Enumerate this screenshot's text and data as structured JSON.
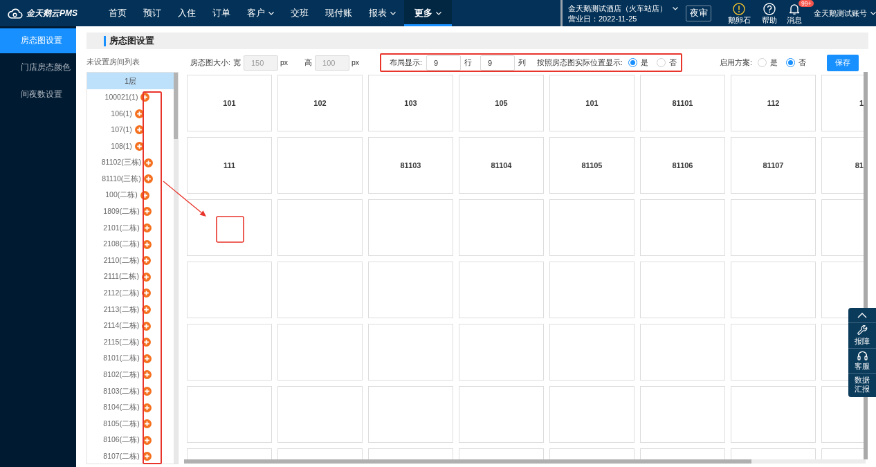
{
  "navbar": {
    "logo": "金天鹅云PMS",
    "items": [
      {
        "label": "首页",
        "dropdown": false,
        "selected": false
      },
      {
        "label": "预订",
        "dropdown": false,
        "selected": false
      },
      {
        "label": "入住",
        "dropdown": false,
        "selected": false
      },
      {
        "label": "订单",
        "dropdown": false,
        "selected": false
      },
      {
        "label": "客户",
        "dropdown": true,
        "selected": false
      },
      {
        "label": "交班",
        "dropdown": false,
        "selected": false
      },
      {
        "label": "现付账",
        "dropdown": false,
        "selected": false
      },
      {
        "label": "报表",
        "dropdown": true,
        "selected": false
      },
      {
        "label": "更多",
        "dropdown": true,
        "selected": true
      }
    ],
    "hotel": {
      "name": "金天鹅测试酒店（火车站店）",
      "business_date": "营业日：2022-11-25"
    },
    "night_audit_button": "夜审",
    "tools": [
      {
        "kind": "alert",
        "label": "鹅卵石"
      },
      {
        "kind": "help",
        "label": "帮助"
      },
      {
        "kind": "messages",
        "label": "消息",
        "badge": "99+"
      }
    ],
    "account": "金天鹅测试账号"
  },
  "sidebar": {
    "items": [
      {
        "label": "房态图设置",
        "selected": true
      },
      {
        "label": "门店房态颜色",
        "selected": false
      },
      {
        "label": "间夜数设置",
        "selected": false
      }
    ]
  },
  "panel": {
    "title": "房态图设置"
  },
  "room_list": {
    "title": "未设置房间列表",
    "floor": "1层",
    "rooms": [
      "100021(1)",
      "106(1)",
      "107(1)",
      "108(1)",
      "81102(三栋)",
      "81110(三栋)",
      "100(二栋)",
      "1809(二栋)",
      "2101(二栋)",
      "2108(二栋)",
      "2110(二栋)",
      "2111(二栋)",
      "2112(二栋)",
      "2113(二栋)",
      "2114(二栋)",
      "2115(二栋)",
      "8101(二栋)",
      "8102(二栋)",
      "8103(二栋)",
      "8104(二栋)",
      "8105(二栋)",
      "8106(二栋)",
      "8107(二栋)"
    ]
  },
  "toolbar": {
    "size": {
      "label": "房态图大小:",
      "fields": [
        {
          "label": "宽",
          "value": "150",
          "unit": "px",
          "disabled": true
        },
        {
          "label": "高",
          "value": "100",
          "unit": "px",
          "disabled": true
        }
      ]
    },
    "layout": {
      "highlighted": true,
      "label": "布局显示:",
      "fields": [
        {
          "value": "9",
          "unit": "行",
          "disabled": false
        },
        {
          "value": "9",
          "unit": "列",
          "disabled": false
        }
      ],
      "position_label": "按照房态图实际位置显示:",
      "position_options": [
        {
          "label": "是",
          "selected": true
        },
        {
          "label": "否",
          "selected": false
        }
      ]
    },
    "scheme": {
      "label": "启用方案:",
      "options": [
        {
          "label": "是",
          "selected": false
        },
        {
          "label": "否",
          "selected": true
        }
      ]
    },
    "save_button": "保存"
  },
  "grid": {
    "rows": [
      [
        {
          "kind": "room",
          "label": "101"
        },
        {
          "kind": "room",
          "label": "102"
        },
        {
          "kind": "room",
          "label": "103"
        },
        {
          "kind": "room",
          "label": "105"
        },
        {
          "kind": "room",
          "label": "101"
        },
        {
          "kind": "room",
          "label": "81101"
        },
        {
          "kind": "room",
          "label": "112"
        },
        {
          "kind": "room",
          "label": "1"
        }
      ],
      [
        {
          "kind": "room",
          "label": "111"
        },
        {
          "kind": "empty"
        },
        {
          "kind": "room",
          "label": "81103"
        },
        {
          "kind": "room",
          "label": "81104"
        },
        {
          "kind": "room",
          "label": "81105"
        },
        {
          "kind": "room",
          "label": "81106"
        },
        {
          "kind": "room",
          "label": "81107"
        },
        {
          "kind": "room",
          "label": "81"
        }
      ],
      [
        {
          "kind": "empty"
        },
        {
          "kind": "empty"
        },
        {
          "kind": "empty"
        },
        {
          "kind": "empty"
        },
        {
          "kind": "empty"
        },
        {
          "kind": "empty"
        },
        {
          "kind": "empty"
        },
        {
          "kind": "empty"
        }
      ],
      [
        {
          "kind": "empty"
        },
        {
          "kind": "empty"
        },
        {
          "kind": "empty"
        },
        {
          "kind": "empty"
        },
        {
          "kind": "empty"
        },
        {
          "kind": "empty"
        },
        {
          "kind": "empty"
        },
        {
          "kind": "empty"
        }
      ],
      [
        {
          "kind": "empty"
        },
        {
          "kind": "empty"
        },
        {
          "kind": "empty"
        },
        {
          "kind": "empty"
        },
        {
          "kind": "empty"
        },
        {
          "kind": "empty"
        },
        {
          "kind": "empty"
        },
        {
          "kind": "empty"
        }
      ],
      [
        {
          "kind": "empty"
        },
        {
          "kind": "empty"
        },
        {
          "kind": "empty"
        },
        {
          "kind": "empty"
        },
        {
          "kind": "empty"
        },
        {
          "kind": "empty"
        },
        {
          "kind": "empty"
        },
        {
          "kind": "empty"
        }
      ],
      [
        {
          "kind": "empty"
        },
        {
          "kind": "empty"
        },
        {
          "kind": "empty"
        },
        {
          "kind": "empty"
        },
        {
          "kind": "empty"
        },
        {
          "kind": "empty"
        },
        {
          "kind": "empty"
        },
        {
          "kind": "empty"
        }
      ]
    ]
  },
  "floating_toolbar": {
    "items": [
      {
        "kind": "top"
      },
      {
        "kind": "report",
        "label": "报障"
      },
      {
        "kind": "service",
        "label": "客服"
      },
      {
        "kind": "data",
        "label": "数据汇报"
      }
    ]
  },
  "annotations": [
    {
      "kind": "frame"
    },
    {
      "kind": "arrow"
    },
    {
      "kind": "square"
    }
  ]
}
